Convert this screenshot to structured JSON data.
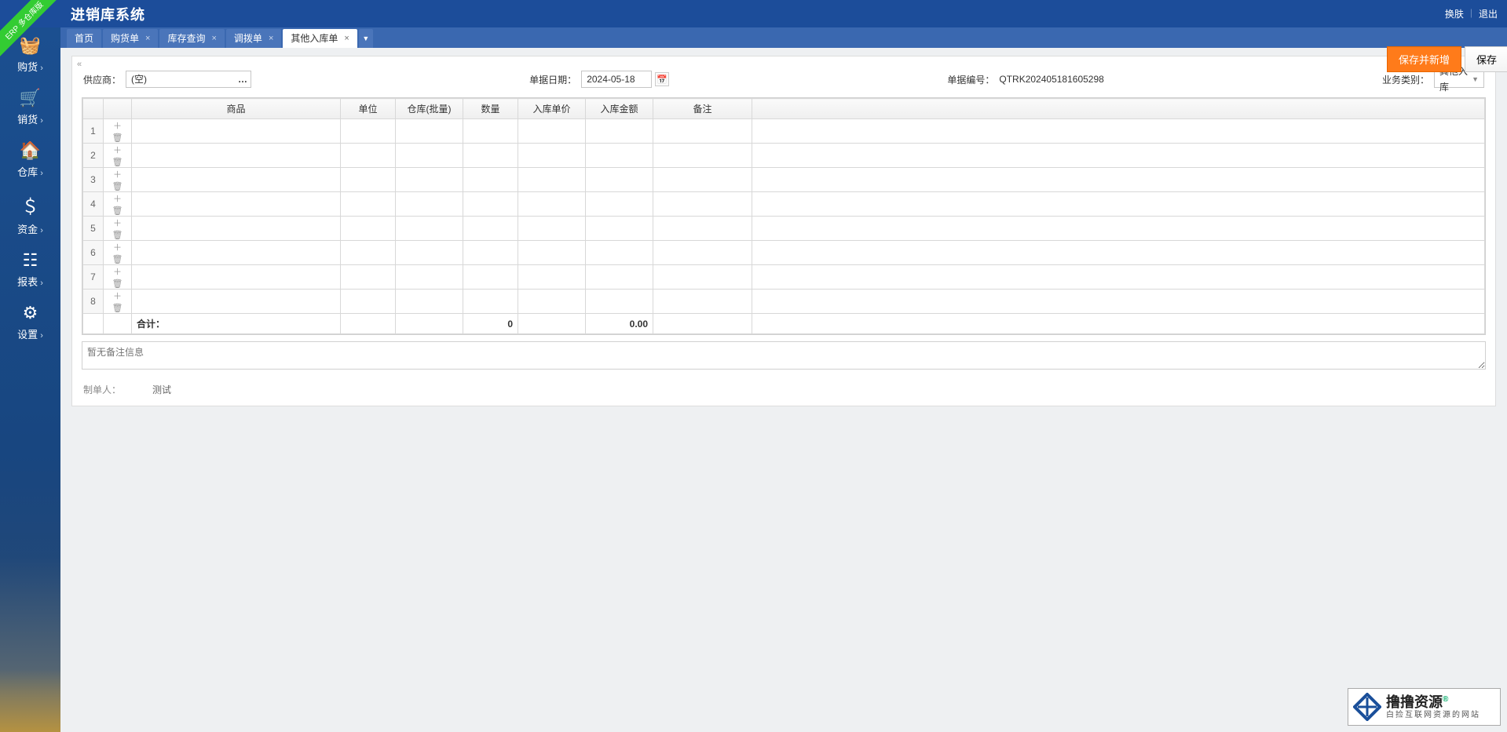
{
  "app": {
    "ribbon": "ERP 多仓库版",
    "title": "进销库系统",
    "links": {
      "skin": "换肤",
      "logout": "退出"
    }
  },
  "sidebar": {
    "items": [
      {
        "icon": "🧺",
        "label": "购货"
      },
      {
        "icon": "🛒",
        "label": "销货"
      },
      {
        "icon": "🏠",
        "label": "仓库"
      },
      {
        "icon": "＄",
        "label": "资金"
      },
      {
        "icon": "☷",
        "label": "报表"
      },
      {
        "icon": "⚙",
        "label": "设置"
      }
    ]
  },
  "tabs": {
    "items": [
      {
        "label": "首页",
        "closable": false
      },
      {
        "label": "购货单",
        "closable": true
      },
      {
        "label": "库存查询",
        "closable": true
      },
      {
        "label": "调拨单",
        "closable": true
      },
      {
        "label": "其他入库单",
        "closable": true,
        "active": true
      }
    ]
  },
  "actions": {
    "save_new": "保存并新增",
    "save": "保存"
  },
  "form": {
    "supplier_label": "供应商：",
    "supplier_value": "(空)",
    "date_label": "单据日期：",
    "date_value": "2024-05-18",
    "docno_label": "单据编号：",
    "docno_value": "QTRK202405181605298",
    "biztype_label": "业务类别：",
    "biztype_value": "其他入库"
  },
  "table": {
    "headers": {
      "product": "商品",
      "unit": "单位",
      "warehouse": "仓库(批量)",
      "qty": "数量",
      "price": "入库单价",
      "amount": "入库金额",
      "remark": "备注"
    },
    "rows": [
      1,
      2,
      3,
      4,
      5,
      6,
      7,
      8
    ],
    "total_label": "合计：",
    "total_qty": "0",
    "total_amount": "0.00"
  },
  "notes": {
    "placeholder": "暂无备注信息"
  },
  "creator": {
    "label": "制单人：",
    "value": "测试"
  },
  "brand": {
    "main": "撸撸资源",
    "reg": "®",
    "sub": "白捡互联网资源的网站"
  }
}
